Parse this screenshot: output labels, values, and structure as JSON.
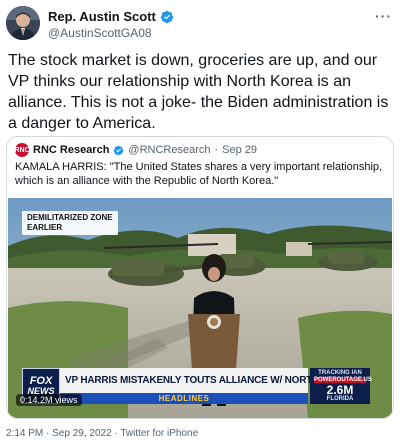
{
  "author": {
    "display_name": "Rep. Austin Scott",
    "handle": "@AustinScottGA08",
    "verified": true
  },
  "more_icon": "more-horizontal-icon",
  "tweet_text": "The stock market is down, groceries are up, and our VP thinks our relationship with North Korea is an alliance. This is not a joke- the Biden administration is a danger to America.",
  "quoted_tweet": {
    "avatar_text": "RNC",
    "display_name": "RNC Research",
    "handle": "@RNCResearch",
    "separator": "·",
    "date": "Sep 29",
    "text": "KAMALA HARRIS: \"The United States shares a very important relationship, which is an alliance with the Republic of North Korea.\"",
    "video": {
      "location_tag_line1": "DEMILITARIZED ZONE",
      "location_tag_line2": "EARLIER",
      "network_logo_line1": "FOX",
      "network_logo_line2": "NEWS",
      "chyron": "VP HARRIS MISTAKENLY TOUTS ALLIANCE W/ NORTH KOREA",
      "headlines_label": "HEADLINES",
      "tracker_label": "TRACKING IAN",
      "tracker_sub": "POWEROUTAGE.US",
      "tracker_value": "2.6M",
      "tracker_region": "FLORIDA",
      "views": "0:14.2M views"
    }
  },
  "timestamp": "2:14 PM · Sep 29, 2022 · Twitter for iPhone",
  "colors": {
    "verified_blue": "#1d9bf0",
    "secondary_text": "#536471",
    "fox_navy": "#0b1f4a",
    "headline_blue": "#1d4fb8",
    "rnc_red": "#c8102e"
  }
}
